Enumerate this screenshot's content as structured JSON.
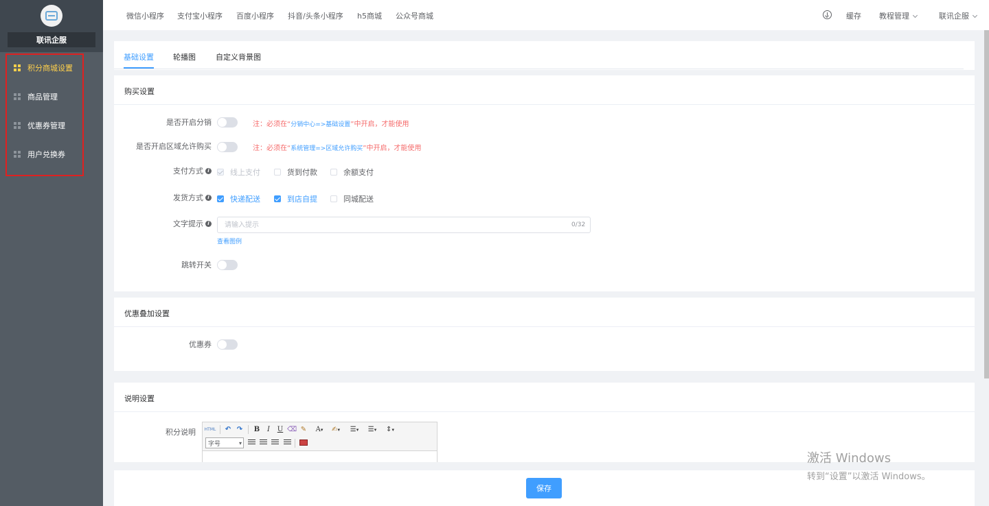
{
  "sidebar": {
    "company": "联讯企服",
    "items": [
      {
        "label": "积分商城设置",
        "active": true
      },
      {
        "label": "商品管理",
        "active": false
      },
      {
        "label": "优惠券管理",
        "active": false
      },
      {
        "label": "用户兑换券",
        "active": false
      }
    ]
  },
  "topbar": {
    "tabs": [
      "微信小程序",
      "支付宝小程序",
      "百度小程序",
      "抖音/头条小程序",
      "h5商城",
      "公众号商城"
    ],
    "cache": "缓存",
    "tutorial": "教程管理",
    "user": "联讯企服"
  },
  "tabs": {
    "items": [
      "基础设置",
      "轮播图",
      "自定义背景图"
    ],
    "active": "基础设置"
  },
  "purchase": {
    "title": "购买设置",
    "distribution_label": "是否开启分销",
    "distribution_note_prefix": "注：必须在“",
    "distribution_note_path": "分销中心=>基础设置",
    "distribution_note_suffix": "”中开启，才能使用",
    "region_label": "是否开启区域允许购买",
    "region_note_prefix": "注：必须在“",
    "region_note_path": "系统管理=>区域允许购买",
    "region_note_suffix": "”中开启，才能使用",
    "payment_label": "支付方式",
    "payment_options": [
      "线上支付",
      "货到付款",
      "余额支付"
    ],
    "delivery_label": "发货方式",
    "delivery_options": [
      "快递配送",
      "到店自提",
      "同城配送"
    ],
    "tip_label": "文字提示",
    "tip_placeholder": "请输入提示",
    "tip_counter": "0/32",
    "example_link": "查看图例",
    "jump_label": "跳转开关"
  },
  "stacking": {
    "title": "优惠叠加设置",
    "coupon_label": "优惠券"
  },
  "description": {
    "title": "说明设置",
    "points_label": "积分说明",
    "editor": {
      "html": "HTML",
      "bold": "B",
      "italic": "I",
      "underline": "U",
      "font_color": "A",
      "font_size": "字号"
    }
  },
  "footer": {
    "save": "保存"
  },
  "watermark": {
    "line1": "激活 Windows",
    "line2": "转到“设置”以激活 Windows。"
  }
}
